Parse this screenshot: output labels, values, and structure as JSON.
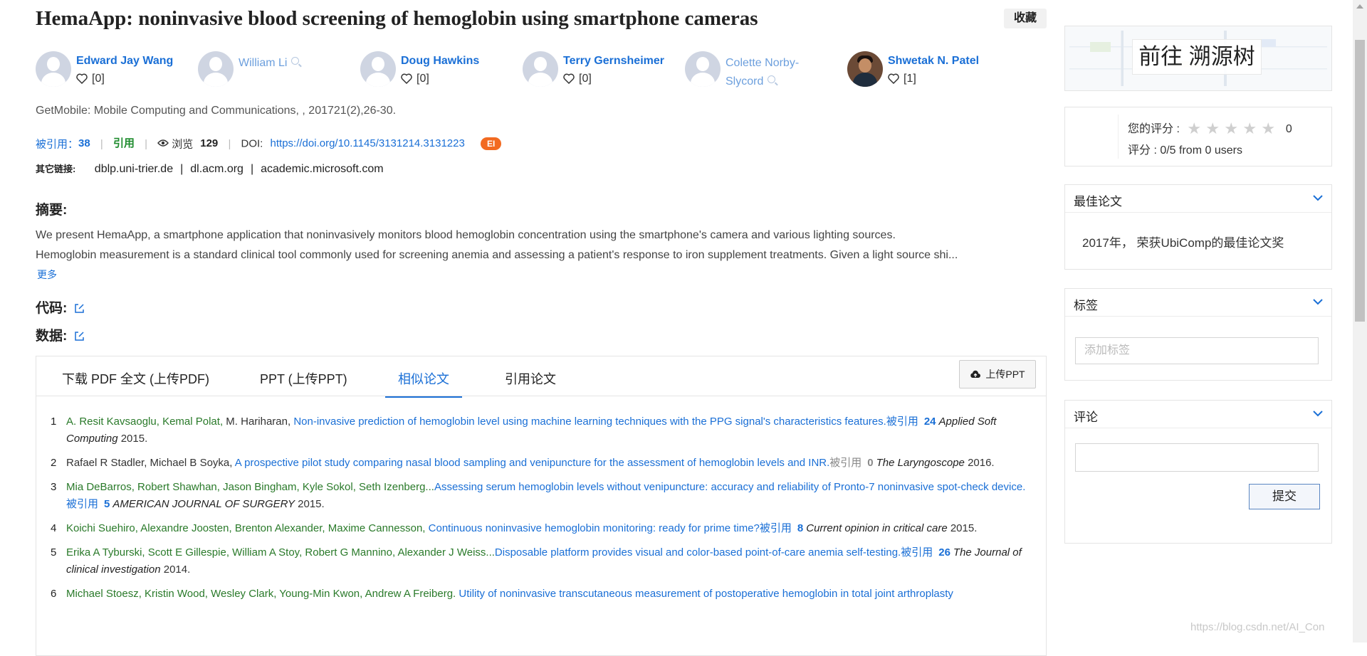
{
  "paper": {
    "title": "HemaApp: noninvasive blood screening of hemoglobin using smartphone cameras",
    "favorite_label": "收藏",
    "venue": "GetMobile: Mobile Computing and Communications, , 201721(2),26-30.",
    "authors": [
      {
        "name": "Edward Jay Wang",
        "likes": "[0]",
        "avatar": "placeholder",
        "linked": true
      },
      {
        "name": "William Li",
        "likes": "",
        "avatar": "placeholder",
        "linked": false
      },
      {
        "name": "Doug Hawkins",
        "likes": "[0]",
        "avatar": "placeholder",
        "linked": true
      },
      {
        "name": "Terry Gernsheimer",
        "likes": "[0]",
        "avatar": "placeholder",
        "linked": true
      },
      {
        "name": "Colette Norby-Slycord",
        "likes": "",
        "avatar": "placeholder",
        "linked": false
      },
      {
        "name": "Shwetak N. Patel",
        "likes": "[1]",
        "avatar": "photo",
        "linked": true
      }
    ],
    "metrics": {
      "cited_label": "被引用：",
      "cited_count": "38",
      "cite_label": "引用",
      "views_label": "浏览",
      "views_count": "129",
      "doi_label": "DOI:",
      "doi": "https://doi.org/10.1145/3131214.3131223",
      "badge": "EI"
    },
    "other_links": {
      "label": "其它链接:",
      "links": [
        "dblp.uni-trier.de",
        "dl.acm.org",
        "academic.microsoft.com"
      ]
    },
    "abstract": {
      "label": "摘要:",
      "line1": "We present HemaApp, a smartphone application that noninvasively monitors blood hemoglobin concentration using the smartphone's camera and various lighting sources.",
      "line2": "Hemoglobin measurement is a standard clinical tool commonly used for screening anemia and assessing a patient's response to iron supplement treatments. Given a light source shi...",
      "more": "更多"
    },
    "code_label": "代码:",
    "data_label": "数据:"
  },
  "tabs": {
    "items": [
      "下载 PDF 全文 (上传PDF)",
      "PPT (上传PPT)",
      "相似论文",
      "引用论文"
    ],
    "active": "相似论文",
    "upload_label": "上传PPT"
  },
  "similar_papers": [
    {
      "n": "1",
      "authors": "A. Resit Kavsaoglu, Kemal Polat, ",
      "authors_b": "M. Hariharan, ",
      "title": "Non-invasive prediction of hemoglobin level using machine learning techniques with the PPG signal's characteristics features.",
      "cited_label": "被引用",
      "cited": "24",
      "journal": "Applied Soft Computing",
      "year": "2015."
    },
    {
      "n": "2",
      "authors": "",
      "authors_b": "Rafael R Stadler, Michael B Soyka, ",
      "title": "A prospective pilot study comparing nasal blood sampling and venipuncture for the assessment of hemoglobin levels and INR.",
      "cited_label": "被引用",
      "cited": "0",
      "journal": "The Laryngoscope",
      "year": "2016."
    },
    {
      "n": "3",
      "authors": "Mia DeBarros, Robert Shawhan, Jason Bingham, Kyle Sokol, Seth Izenberg...",
      "authors_b": "",
      "title": "Assessing serum hemoglobin levels without venipuncture: accuracy and reliability of Pronto-7 noninvasive spot-check device.",
      "cited_label": "被引用",
      "cited": "5",
      "journal": "AMERICAN JOURNAL OF SURGERY",
      "year": "2015."
    },
    {
      "n": "4",
      "authors": "Koichi Suehiro, Alexandre Joosten, Brenton Alexander, Maxime Cannesson, ",
      "authors_b": "",
      "title": "Continuous noninvasive hemoglobin monitoring: ready for prime time?",
      "cited_label": "被引用",
      "cited": "8",
      "journal": "Current opinion in critical care",
      "year": "2015."
    },
    {
      "n": "5",
      "authors": "Erika A Tyburski, Scott E Gillespie, William A Stoy, Robert G Mannino, Alexander J Weiss...",
      "authors_b": "",
      "title": "Disposable platform provides visual and color-based point-of-care anemia self-testing.",
      "cited_label": "被引用",
      "cited": "26",
      "journal": "The Journal of clinical investigation",
      "year": "2014."
    },
    {
      "n": "6",
      "authors": "Michael Stoesz, Kristin Wood, Wesley Clark, Young-Min Kwon, Andrew A Freiberg. ",
      "authors_b": "",
      "title": "Utility of noninvasive transcutaneous measurement of postoperative hemoglobin in total joint arthroplasty",
      "cited_label": "",
      "cited": "",
      "journal": "",
      "year": ""
    }
  ],
  "sidebar": {
    "trace_tree_label": "前往 溯源树",
    "rating": {
      "your_rating_label": "您的评分 :",
      "your_rating_value": "0",
      "stars": 5,
      "summary": "评分 : 0/5 from 0 users"
    },
    "best_paper": {
      "title": "最佳论文",
      "text": "2017年， 荣获UbiComp的最佳论文奖"
    },
    "tags": {
      "title": "标签",
      "placeholder": "添加标签"
    },
    "comments": {
      "title": "评论",
      "submit": "提交"
    }
  },
  "watermark": "https://blog.csdn.net/AI_Con",
  "colors": {
    "link_blue": "#1a6fd6",
    "author_green": "#2a7a2a",
    "badge_orange": "#f26a21",
    "cite_green": "#1f8c2e"
  }
}
